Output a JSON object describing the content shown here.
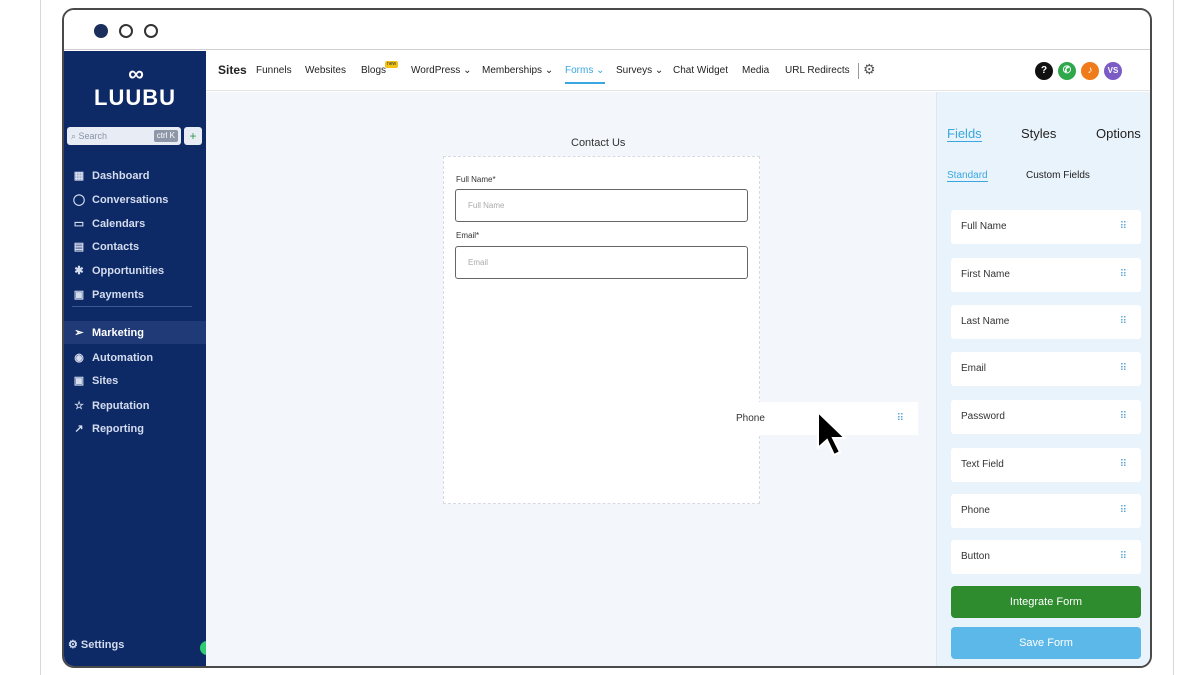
{
  "window": {
    "controls": [
      "close",
      "minimize",
      "maximize"
    ]
  },
  "sidebar": {
    "logo_mark": "∞",
    "logo_text": "LUUBU",
    "search_placeholder": "Search",
    "search_shortcut": "ctrl K",
    "search_add": "+",
    "items": [
      {
        "label": "Dashboard",
        "icon": "grid-icon"
      },
      {
        "label": "Conversations",
        "icon": "chat-icon"
      },
      {
        "label": "Calendars",
        "icon": "calendar-icon"
      },
      {
        "label": "Contacts",
        "icon": "contacts-icon"
      },
      {
        "label": "Opportunities",
        "icon": "opportunities-icon"
      },
      {
        "label": "Payments",
        "icon": "payments-icon"
      },
      {
        "label": "Marketing",
        "icon": "send-icon",
        "active": true
      },
      {
        "label": "Automation",
        "icon": "automation-icon"
      },
      {
        "label": "Sites",
        "icon": "sites-icon"
      },
      {
        "label": "Reputation",
        "icon": "star-icon"
      },
      {
        "label": "Reporting",
        "icon": "trend-icon"
      }
    ],
    "settings_label": "Settings"
  },
  "topnav": {
    "section": "Sites",
    "items": [
      "Funnels",
      "Websites",
      "Blogs",
      "WordPress",
      "Memberships",
      "Forms",
      "Surveys",
      "Chat Widget",
      "Media",
      "URL Redirects"
    ],
    "active": "Forms",
    "new_badge": "new",
    "user_initials": "VS",
    "help_glyph": "?",
    "colors": {
      "active": "#3aa7e0",
      "help": "#111111",
      "phone": "#2ea84a",
      "notify": "#f07b1a",
      "avatar": "#7b5cc4"
    }
  },
  "canvas": {
    "form_title": "Contact Us",
    "fields": [
      {
        "label": "Full Name*",
        "placeholder": "Full Name"
      },
      {
        "label": "Email*",
        "placeholder": "Email"
      }
    ],
    "dragging_item": "Phone"
  },
  "right_panel": {
    "tabs": [
      "Fields",
      "Styles",
      "Options"
    ],
    "active_tab": "Fields",
    "subtabs": [
      "Standard",
      "Custom Fields"
    ],
    "active_subtab": "Standard",
    "fields": [
      "Full Name",
      "First Name",
      "Last Name",
      "Email",
      "Password",
      "Text Field",
      "Phone",
      "Button"
    ],
    "integrate_button": "Integrate Form",
    "save_button": "Save Form",
    "colors": {
      "integrate": "#2e8b2e",
      "save": "#5cb8e8"
    }
  }
}
